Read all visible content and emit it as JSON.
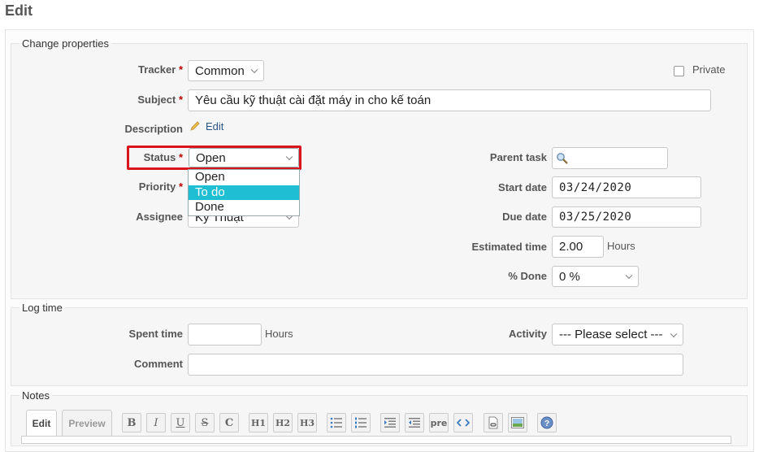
{
  "page": {
    "title": "Edit"
  },
  "properties": {
    "legend": "Change properties",
    "tracker": {
      "label": "Tracker",
      "value": "Common"
    },
    "private": {
      "label": "Private",
      "checked": false
    },
    "subject": {
      "label": "Subject",
      "value": "Yêu cầu kỹ thuật cài đặt máy in cho kế toán"
    },
    "description": {
      "label": "Description",
      "edit_link": "Edit"
    },
    "status": {
      "label": "Status",
      "value": "Open",
      "options": [
        "Open",
        "To do",
        "Done"
      ],
      "highlighted_option": "To do"
    },
    "priority": {
      "label": "Priority"
    },
    "assignee": {
      "label": "Assignee",
      "value": "Kỹ Thuật"
    },
    "parent_task": {
      "label": "Parent task",
      "value": ""
    },
    "start_date": {
      "label": "Start date",
      "value": "03/24/2020"
    },
    "due_date": {
      "label": "Due date",
      "value": "03/25/2020"
    },
    "estimated_time": {
      "label": "Estimated time",
      "value": "2.00",
      "unit": "Hours"
    },
    "done": {
      "label": "% Done",
      "value": "0 %"
    },
    "required_mark": "*"
  },
  "log_time": {
    "legend": "Log time",
    "spent_time": {
      "label": "Spent time",
      "value": "",
      "unit": "Hours"
    },
    "activity": {
      "label": "Activity",
      "value": "--- Please select ---"
    },
    "comment": {
      "label": "Comment",
      "value": ""
    }
  },
  "notes": {
    "legend": "Notes",
    "tabs": {
      "edit": "Edit",
      "preview": "Preview"
    },
    "toolbar": {
      "bold": "B",
      "italic": "I",
      "underline": "U",
      "strike": "S",
      "code": "C",
      "h1": "H1",
      "h2": "H2",
      "h3": "H3",
      "pre": "pre"
    }
  }
}
